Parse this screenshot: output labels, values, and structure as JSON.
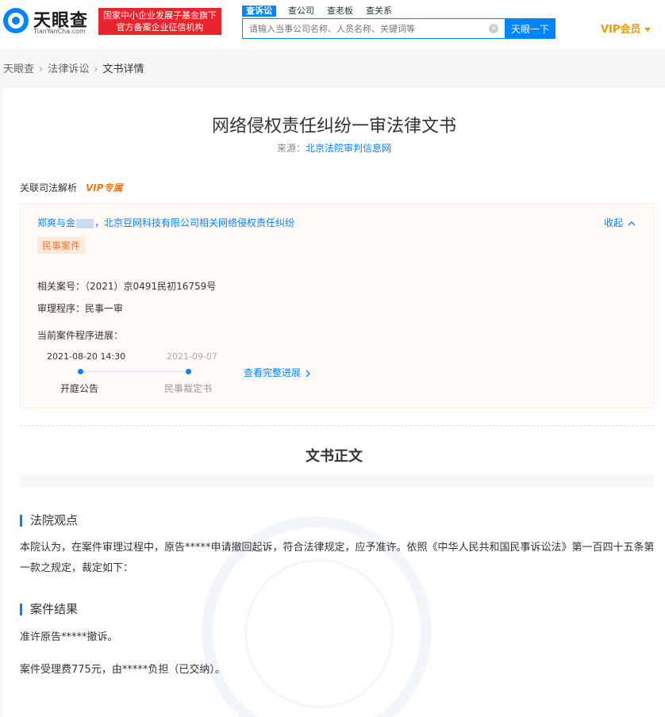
{
  "header": {
    "logo_name": "天眼查",
    "logo_domain": "TianYanCha.com",
    "badge_line1": "国家中小企业发展子基金旗下",
    "badge_line2": "官方备案企业征信机构",
    "search_tabs": [
      "查诉讼",
      "查公司",
      "查老板",
      "查关系"
    ],
    "search_placeholder": "请输入当事公司名称、人员名称、关键词等",
    "search_button": "天眼一下",
    "vip_label": "VIP会员"
  },
  "breadcrumb": [
    "天眼查",
    "法律诉讼",
    "文书详情"
  ],
  "document": {
    "title": "网络侵权责任纠纷一审法律文书",
    "source_label": "来源：",
    "source_link": "北京法院审判信息网"
  },
  "judicial": {
    "label": "关联司法解析",
    "vip_tag": "VIP专属",
    "case_title_prefix": "郑爽与金",
    "case_title_suffix": "，北京豆网科技有限公司相关网络侵权责任纠纷",
    "collapse_label": "收起",
    "case_type": "民事案件",
    "case_number": "相关案号：（2021）京0491民初16759号",
    "procedure": "审理程序：民事一审",
    "progress_label": "当前案件程序进展：",
    "timeline": [
      {
        "date": "2021-08-20 14:30",
        "label": "开庭公告"
      },
      {
        "date": "2021-09-07",
        "label": "民事裁定书"
      }
    ],
    "view_full": "查看完整进展"
  },
  "body": {
    "title": "文书正文",
    "sections": [
      {
        "heading": "法院观点",
        "paragraphs": [
          "本院认为，在案件审理过程中，原告*****申请撤回起诉，符合法律规定，应予准许。依照《中华人民共和国民事诉讼法》第一百四十五条第一款之规定，裁定如下："
        ]
      },
      {
        "heading": "案件结果",
        "paragraphs": [
          "准许原告*****撤诉。",
          "案件受理费775元，由*****负担（已交纳）。"
        ]
      }
    ]
  },
  "colors": {
    "accent": "#0084ff",
    "badge_red": "#e8242c",
    "vip_orange": "#f39800"
  }
}
